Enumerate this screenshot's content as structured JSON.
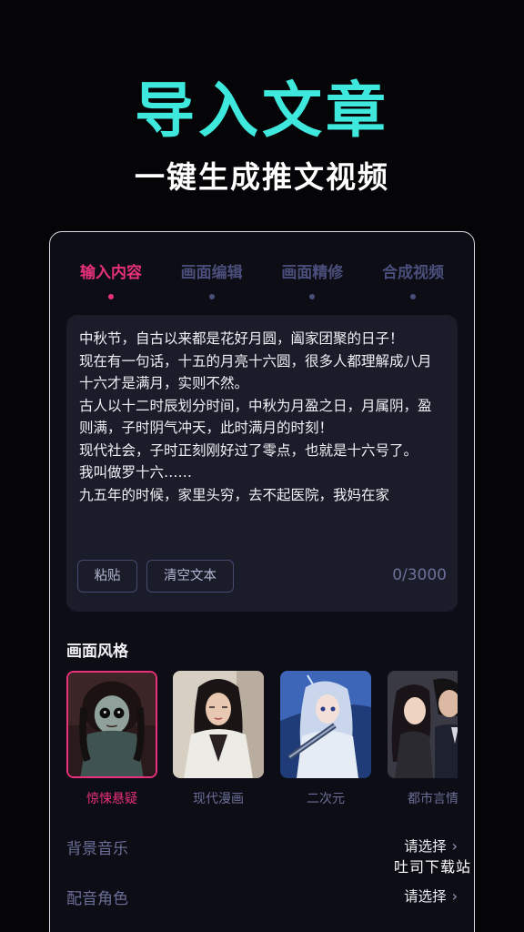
{
  "hero": {
    "title": "导入文章",
    "subtitle": "一键生成推文视频"
  },
  "steps": [
    {
      "label": "输入内容",
      "active": true
    },
    {
      "label": "画面编辑",
      "active": false
    },
    {
      "label": "画面精修",
      "active": false
    },
    {
      "label": "合成视频",
      "active": false
    }
  ],
  "editor": {
    "text": "中秋节，自古以来都是花好月圆，阖家团聚的日子！\n现在有一句话，十五的月亮十六圆，很多人都理解成八月十六才是满月，实则不然。\n古人以十二时辰划分时间，中秋为月盈之日，月属阴，盈则满，子时阴气冲天，此时满月的时刻！\n现代社会，子时正刻刚好过了零点，也就是十六号了。\n我叫做罗十六……\n九五年的时候，家里头穷，去不起医院，我妈在家",
    "paste_label": "粘贴",
    "clear_label": "清空文本",
    "char_count": "0/3000"
  },
  "style_section": {
    "title": "画面风格",
    "items": [
      {
        "name": "惊悚悬疑",
        "active": true
      },
      {
        "name": "现代漫画",
        "active": false
      },
      {
        "name": "二次元",
        "active": false
      },
      {
        "name": "都市言情",
        "active": false
      }
    ]
  },
  "settings": {
    "background_music": {
      "label": "背景音乐",
      "value": "请选择"
    },
    "voice_role": {
      "label": "配音角色",
      "value": "请选择"
    }
  },
  "watermark": "吐司下载站",
  "colors": {
    "accent_cyan": "#3ee8dd",
    "accent_pink": "#e8317a",
    "inactive": "#4a4e7a",
    "card_bg": "#0d0d16",
    "editor_bg": "#1a1c2a"
  }
}
